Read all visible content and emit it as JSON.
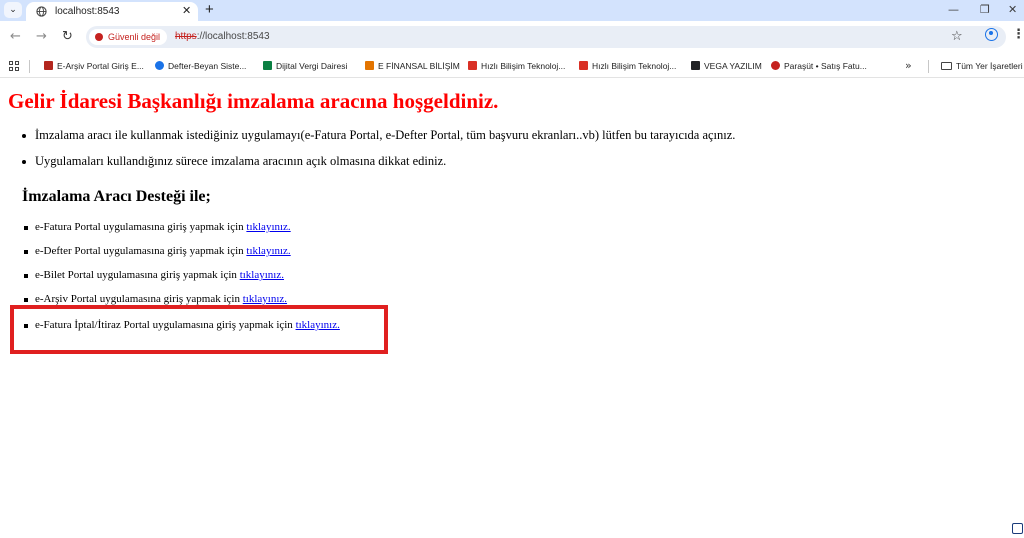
{
  "browser": {
    "tab": {
      "title": "localhost:8543",
      "close_label": "✕"
    },
    "new_tab_label": "+",
    "window_controls": {
      "minimize": "—",
      "restore": "❐",
      "close": "✕"
    },
    "nav": {
      "back": "←",
      "forward": "→",
      "reload": "↻"
    },
    "security_chip": "Güvenli değil",
    "url_scheme": "https",
    "url_rest": "://localhost:8543",
    "star": "☆",
    "menu": "⋮",
    "bookmarks": [
      {
        "label": "E-Arşiv Portal Giriş E...",
        "icon": "doc-icon",
        "color": "#b3261e"
      },
      {
        "label": "Defter-Beyan Siste...",
        "icon": "defter-icon",
        "color": "#1a73e8"
      },
      {
        "label": "Dijital Vergi Dairesi",
        "icon": "vergi-icon",
        "color": "#0b8043"
      },
      {
        "label": "E FİNANSAL BİLİŞİM",
        "icon": "finansal-icon",
        "color": "#e37400"
      },
      {
        "label": "Hızlı Bilişim Teknoloj...",
        "icon": "hizli-icon",
        "color": "#d93025"
      },
      {
        "label": "Hızlı Bilişim Teknoloj...",
        "icon": "hizli-icon",
        "color": "#d93025"
      },
      {
        "label": "VEGA YAZILIM",
        "icon": "vega-icon",
        "color": "#202124"
      },
      {
        "label": "Paraşüt • Satış Fatu...",
        "icon": "parasut-icon",
        "color": "#c5221f"
      }
    ],
    "bookmarks_more": "»",
    "all_bookmarks": "Tüm Yer İşaretleri"
  },
  "page": {
    "heading": "Gelir İdaresi Başkanlığı imzalama aracına hoşgeldiniz.",
    "intro": [
      "İmzalama aracı ile kullanmak istediğiniz uygulamayı(e-Fatura Portal, e-Defter Portal, tüm başvuru ekranları..vb) lütfen bu tarayıcıda açınız.",
      "Uygulamaları kullandığınız sürece imzalama aracının açık olmasına dikkat ediniz."
    ],
    "subheading": "İmzalama Aracı Desteği ile;",
    "link_text": "tıklayınız.",
    "portals": [
      "e-Fatura Portal uygulamasına giriş yapmak için ",
      "e-Defter Portal uygulamasına giriş yapmak için ",
      "e-Bilet Portal uygulamasına giriş yapmak için ",
      "e-Arşiv Portal uygulamasına giriş yapmak için ",
      "e-Fatura İptal/İtiraz Portal uygulamasına giriş yapmak için "
    ]
  },
  "colors": {
    "heading": "#ff0000",
    "link": "#0000ee",
    "highlight_box": "#e02020",
    "tabstrip": "#d3e3fd"
  }
}
